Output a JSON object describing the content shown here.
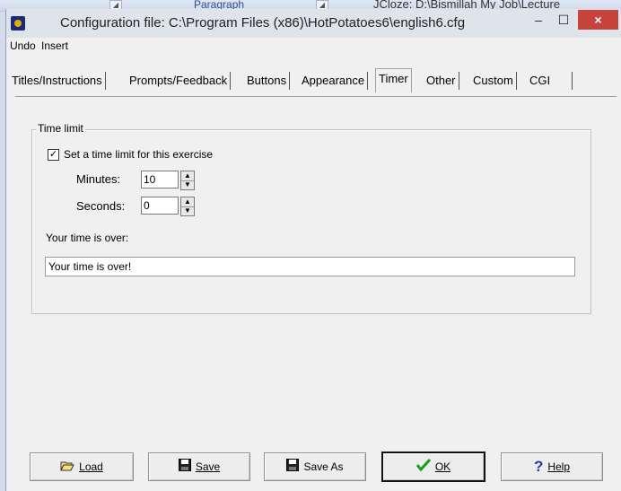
{
  "background": {
    "ribbon_label": "Paragraph",
    "window_title": "JCloze: D:\\Bismillah My Job\\Lecture"
  },
  "window": {
    "title": "Configuration file: C:\\Program Files (x86)\\HotPotatoes6\\english6.cfg",
    "minimize_glyph": "–",
    "maximize_glyph": "☐",
    "close_glyph": "×"
  },
  "menu": {
    "undo": "Undo",
    "insert": "Insert"
  },
  "tabs": [
    {
      "label": "Titles/Instructions"
    },
    {
      "label": "Prompts/Feedback"
    },
    {
      "label": "Buttons"
    },
    {
      "label": "Appearance"
    },
    {
      "label": "Timer",
      "active": true
    },
    {
      "label": "Other"
    },
    {
      "label": "Custom"
    },
    {
      "label": "CGI"
    }
  ],
  "timer": {
    "group_label": "Time limit",
    "checkbox_label": "Set a time limit for this exercise",
    "checkbox_checked": true,
    "minutes_label": "Minutes:",
    "minutes_value": "10",
    "seconds_label": "Seconds:",
    "seconds_value": "0",
    "time_over_label": "Your time is over:",
    "time_over_value": "Your time is over!"
  },
  "buttons": {
    "load": "Load",
    "save": "Save",
    "save_as": "Save As",
    "ok": "OK",
    "help": "Help"
  },
  "icons": {
    "load": "folder-open-icon",
    "save": "floppy-disk-icon",
    "save_as": "floppy-disk-pencil-icon",
    "ok": "green-checkmark-icon",
    "help": "blue-question-mark-icon"
  },
  "colors": {
    "close_button": "#c7443d",
    "ok_check": "#1a9b1a",
    "help_question": "#1a3fa8"
  }
}
